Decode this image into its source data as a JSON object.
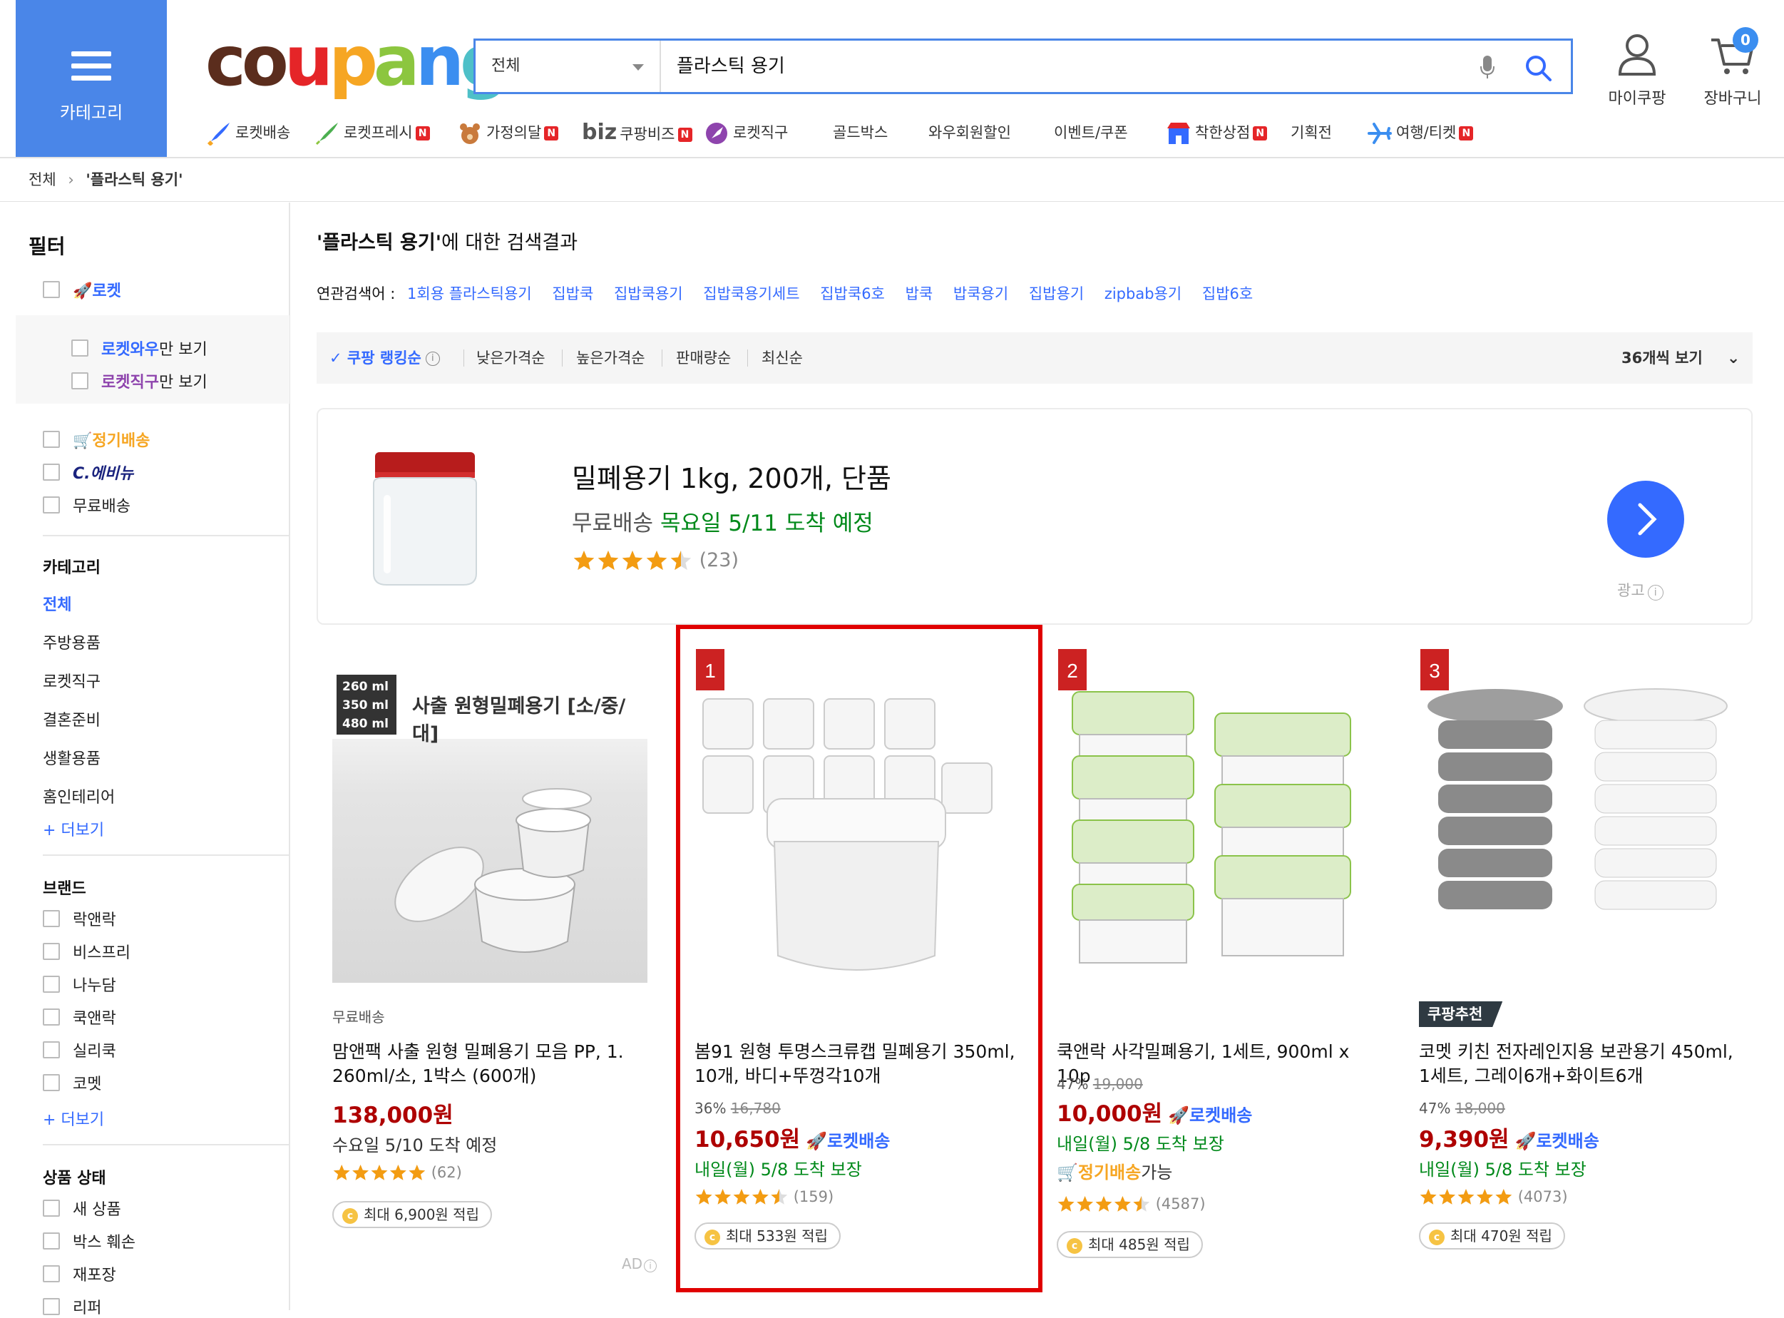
{
  "header": {
    "category_label": "카테고리",
    "logo": "coupang",
    "search": {
      "category": "전체",
      "query": "플라스틱 용기"
    },
    "mypage": "마이쿠팡",
    "cart": "장바구니",
    "cart_count": "0",
    "nav": [
      "로켓배송",
      "로켓프레시",
      "가정의달",
      "쿠팡비즈",
      "로켓직구",
      "골드박스",
      "와우회원할인",
      "이벤트/쿠폰",
      "착한상점",
      "기획전",
      "여행/티켓"
    ],
    "nav_biz_prefix": "biz",
    "nav_badge": "N"
  },
  "breadcrumb": {
    "root": "전체",
    "current": "'플라스틱 용기'"
  },
  "sidebar": {
    "title": "필터",
    "rocket": "로켓",
    "rocket_wow": "로켓와우",
    "rocket_jikgu": "로켓직구",
    "only_suffix": "만 보기",
    "subscription": "정기배송",
    "c_avenue": "C.에비뉴",
    "free_ship": "무료배송",
    "category_title": "카테고리",
    "categories": [
      "전체",
      "주방용품",
      "로켓직구",
      "결혼준비",
      "생활용품",
      "홈인테리어"
    ],
    "more": "+ 더보기",
    "brand_title": "브랜드",
    "brands": [
      "락앤락",
      "비스프리",
      "나누담",
      "쿡앤락",
      "실리쿡",
      "코멧"
    ],
    "condition_title": "상품 상태",
    "conditions": [
      "새 상품",
      "박스 훼손",
      "재포장",
      "리퍼"
    ]
  },
  "main": {
    "result_query": "'플라스틱 용기'",
    "result_suffix": "에 대한 검색결과",
    "related_label": "연관검색어 :",
    "related": [
      "1회용 플라스틱용기",
      "집밥쿡",
      "집밥쿡용기",
      "집밥쿡용기세트",
      "집밥쿡6호",
      "밥쿡",
      "밥쿡용기",
      "집밥용기",
      "zipbab용기",
      "집밥6호"
    ],
    "sort": [
      "쿠팡 랭킹순",
      "낮은가격순",
      "높은가격순",
      "판매량순",
      "최신순"
    ],
    "per_page": "36개씩 보기"
  },
  "ad_banner": {
    "title": "밀폐용기 1kg, 200개, 단품",
    "free_ship": "무료배송",
    "arrival": "목요일 5/11 도착 예정",
    "rating": 4.5,
    "reviews": "(23)",
    "ad_label": "광고"
  },
  "products": [
    {
      "rank": "",
      "tag": "무료배송",
      "image_label_sizes": [
        "260 ml",
        "350 ml",
        "480 ml"
      ],
      "image_label_text": "사출 원형밀폐용기 [소/중/대]",
      "name": "맘앤팩 사출 원형 밀폐용기 모음 PP, 1. 260ml/소, 1박스 (600개)",
      "discount": "",
      "original": "",
      "price": "138,000원",
      "rocket": "",
      "delivery": "수요일 5/10 도착 예정",
      "rating": 5,
      "reviews": "(62)",
      "cashback": "최대 6,900원 적립",
      "ad": "AD"
    },
    {
      "rank": "1",
      "name": "봄91 원형 투명스크류캡 밀폐용기 350ml, 10개, 바디+뚜껑각10개",
      "discount": "36%",
      "original": "16,780",
      "price": "10,650원",
      "rocket": "로켓배송",
      "delivery": "내일(월) 5/8 도착 보장",
      "rating": 4.5,
      "reviews": "(159)",
      "cashback": "최대 533원 적립"
    },
    {
      "rank": "2",
      "name": "쿡앤락 사각밀폐용기, 1세트, 900ml x 10p",
      "discount": "47%",
      "original": "19,000",
      "price": "10,000원",
      "rocket": "로켓배송",
      "delivery": "내일(월) 5/8 도착 보장",
      "subscription": "정기배송",
      "subscription_suffix": "가능",
      "rating": 4.5,
      "reviews": "(4587)",
      "cashback": "최대 485원 적립"
    },
    {
      "rank": "3",
      "badge": "쿠팡추천",
      "name": "코멧 키친 전자레인지용 보관용기 450ml, 1세트, 그레이6개+화이트6개",
      "discount": "47%",
      "original": "18,000",
      "price": "9,390원",
      "rocket": "로켓배송",
      "delivery": "내일(월) 5/8 도착 보장",
      "rating": 5,
      "reviews": "(4073)",
      "cashback": "최대 470원 적립"
    }
  ],
  "colors": {
    "accent": "#346aff",
    "price": "#ae0000",
    "green": "#00891a",
    "highlight": "#e00000",
    "header_blue": "#4a86e8"
  }
}
